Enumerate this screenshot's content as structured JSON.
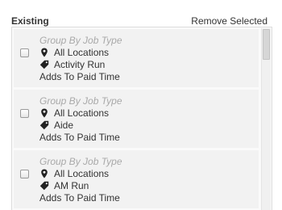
{
  "header": {
    "title": "Existing",
    "remove_selected_label": "Remove Selected"
  },
  "items": [
    {
      "group_label": "Group By Job Type",
      "location": "All Locations",
      "job_type": "Activity Run",
      "paid_time": "Adds To Paid Time",
      "checked": false,
      "location_icon": "map-marker-icon",
      "tag_icon": "tag-icon"
    },
    {
      "group_label": "Group By Job Type",
      "location": "All Locations",
      "job_type": "Aide",
      "paid_time": "Adds To Paid Time",
      "checked": false,
      "location_icon": "map-marker-icon",
      "tag_icon": "tag-icon"
    },
    {
      "group_label": "Group By Job Type",
      "location": "All Locations",
      "job_type": "AM Run",
      "paid_time": "Adds To Paid Time",
      "checked": false,
      "location_icon": "map-marker-icon",
      "tag_icon": "tag-icon"
    }
  ],
  "colors": {
    "item_background": "#f2f2f2",
    "muted_text": "#a9a9a9",
    "text": "#333333"
  }
}
